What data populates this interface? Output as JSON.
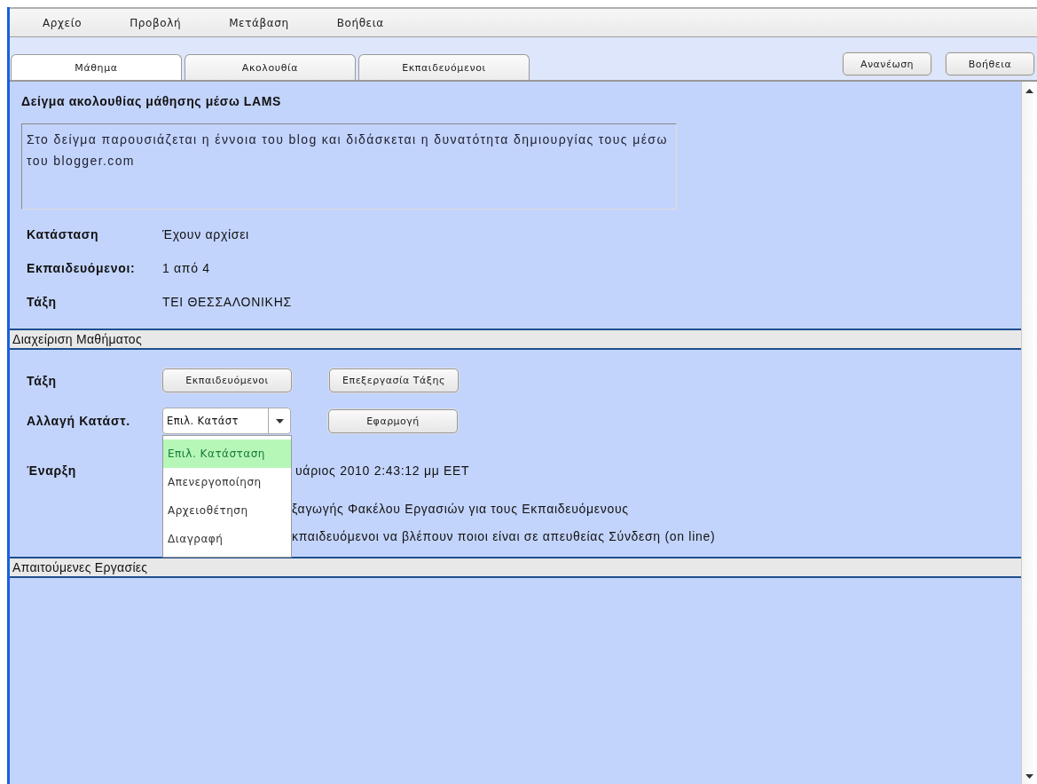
{
  "menu": [
    {
      "label": "Αρχείο"
    },
    {
      "label": "Προβολή"
    },
    {
      "label": "Μετάβαση"
    },
    {
      "label": "Βοήθεια"
    }
  ],
  "tabs": [
    {
      "label": "Μάθημα",
      "selected": true
    },
    {
      "label": "Ακολουθία",
      "selected": false
    },
    {
      "label": "Εκπαιδευόμενοι",
      "selected": false
    }
  ],
  "toolbar_buttons": [
    "Ανανέωση",
    "Βοήθεια"
  ],
  "lesson": {
    "title": "Δείγμα ακολουθίας μάθησης μέσω LAMS",
    "description": "Στο δείγμα παρουσιάζεται η έννοια του blog και διδάσκεται η δυνατότητα δημιουργίας τους μέσω του blogger.com",
    "fields": [
      {
        "label": "Κατάσταση",
        "value": "Έχουν αρχίσει"
      },
      {
        "label": "Εκπαιδευόμενοι:",
        "value": "1 από 4"
      },
      {
        "label": "Τάξη",
        "value": "ΤΕΙ ΘΕΣΣΑΛΟΝΙΚΗΣ"
      }
    ]
  },
  "course_management": {
    "title": "Διαχείριση Μαθήματος",
    "class_label": "Τάξη",
    "class_buttons": [
      "Εκπαιδευόμενοι",
      "Επεξεργασία Τάξης"
    ],
    "status_label": "Αλλαγή Κατάστ.",
    "status_select": {
      "value": "Επιλ. Κατάστ",
      "expanded": true,
      "options": [
        {
          "label": "Επιλ. Κατάσταση",
          "selected": true
        },
        {
          "label": "Απενεργοποίηση",
          "selected": false
        },
        {
          "label": "Αρχειοθέτηση",
          "selected": false
        },
        {
          "label": "Διαγραφή",
          "selected": false
        }
      ]
    },
    "apply_button": "Εφαρμογή",
    "start_label": "Έναρξη",
    "start_value": "υάριος 2010 2:43:12 μμ EET",
    "option_lines": [
      "ξαγωγής Φακέλου  Εργασιών για τους Εκπαιδευόμενους",
      "κπαιδευόμενοι να βλέπουν ποιοι είναι σε απευθείας Σύνδεση (on line)"
    ]
  },
  "required_tasks": {
    "title": "Απαιτούμενες Εργασίες"
  }
}
